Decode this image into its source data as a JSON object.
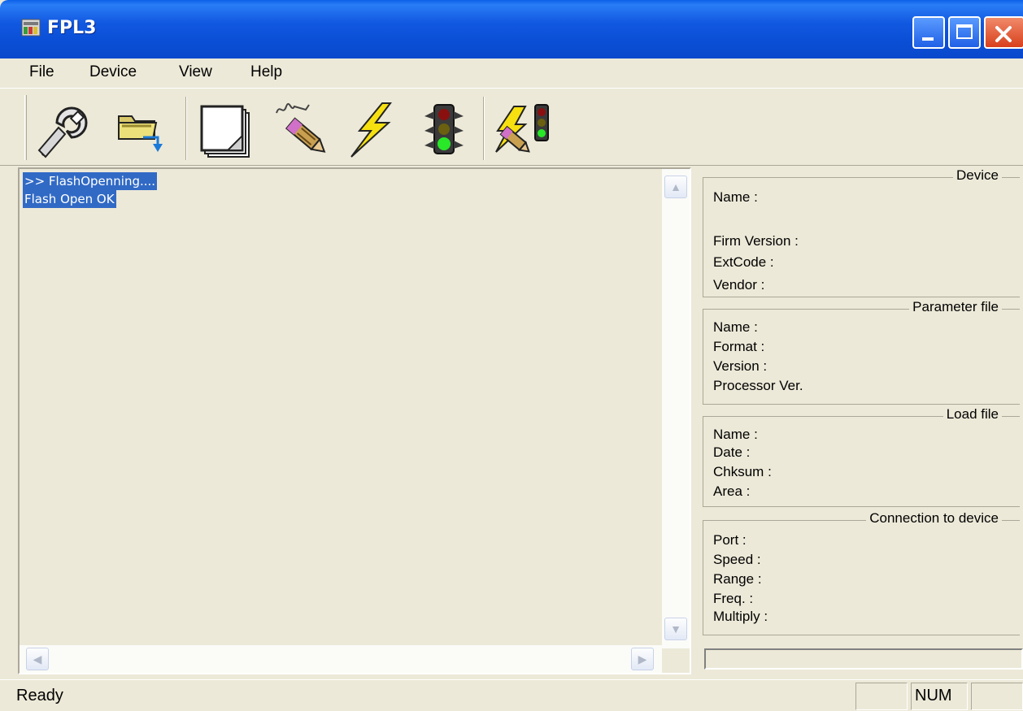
{
  "window": {
    "title": "FPL3"
  },
  "menu": [
    "File",
    "Device",
    "View",
    "Help"
  ],
  "toolbar": {
    "buttons": [
      "settings-wrench-icon",
      "open-folder-icon",
      "new-document-icon",
      "flash-pencil-icon",
      "lightning-icon",
      "traffic-light-icon",
      "lightning-traffic-light-icon"
    ]
  },
  "log": {
    "lines": [
      ">> FlashOpenning....",
      "Flash Open OK"
    ]
  },
  "device": {
    "legend": "Device",
    "name": "Name :",
    "firm_version": "Firm Version :",
    "extcode": "ExtCode :",
    "vendor": "Vendor :"
  },
  "parameter_file": {
    "legend": "Parameter file",
    "name": "Name :",
    "format": "Format :",
    "version": "Version :",
    "processor": "Processor Ver."
  },
  "load_file": {
    "legend": "Load file",
    "name": "Name :",
    "date": "Date :",
    "chksum": "Chksum :",
    "area": "Area :"
  },
  "connection": {
    "legend": "Connection to device",
    "port": "Port :",
    "speed": "Speed :",
    "range": "Range :",
    "freq": "Freq. :",
    "multiply": "Multiply :"
  },
  "status": {
    "text": "Ready",
    "num": "NUM"
  }
}
